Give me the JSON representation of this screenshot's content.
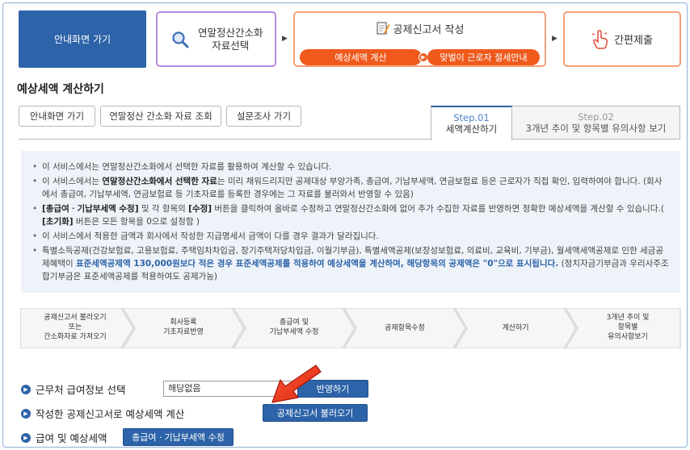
{
  "header": {
    "home_label": "안내화면 가기",
    "step1_line1": "연말정산간소화",
    "step1_line2": "자료선택",
    "step2_title": "공제신고서 작성",
    "step2_pill1": "예상세액 계산",
    "step2_pill2": "맞벌이 근로자 절세안내",
    "step3_label": "간편제출",
    "accent_color": "#2d63a8",
    "orange_color": "#ef5a1c"
  },
  "page_title": "예상세액 계산하기",
  "sub_buttons": {
    "home": "안내화면 가기",
    "simplified_lookup": "연말정산 간소화 자료 조회",
    "survey": "설문조사 가기"
  },
  "tabs": [
    {
      "step": "Step.01",
      "label": "세액계산하기",
      "active": true
    },
    {
      "step": "Step.02",
      "label": "3개년 추이 및 항목별 유의사항 보기",
      "active": false
    }
  ],
  "info": {
    "item1": "이 서비스에서는 연말정산간소화에서 선택한 자료를 활용하여 계산할 수 있습니다.",
    "item2_pre": "이 서비스에서는 ",
    "item2_bold": "연말정산간소화에서 선택한 자료",
    "item2_post": "는 미리 채워드리지만 공제대상 부양가족, 총급여, 기납부세액, 연금보험료 등은 근로자가 직접 확인, 입력하여야 합니다. (회사에서 총급여, 기납부세액, 연금보험료 등 기초자료를 등록한 경우에는 그 자료를 불러와서 반영할 수 있음)",
    "item3_b1": "[총급여ㆍ기납부세액 수정]",
    "item3_mid1": " 및 각 항목의 ",
    "item3_b2": "[수정]",
    "item3_mid2": " 버튼을 클릭하여 올바로 수정하고 연말정산간소화에 없어 추가 수집한 자료를 반영하면 정확한 예상세액을 계산할 수 있습니다.( ",
    "item3_b3": "[초기화]",
    "item3_post": " 버튼은 모든 항목을 0으로 설정함 )",
    "item4": "이 서비스에서 적용한 금액과 회사에서 작성한 지급명세서 금액이 다를 경우 결과가 달라집니다.",
    "item5_pre": "특별소득공제(건강보험료, 고용보험료, 주택임차차입금, 장기주택저당차입금, 이월기부금), 특별세액공제(보장성보험료, 의료비, 교육비, 기부금), 월세액세액공제로 인한 세금공제혜택이 ",
    "item5_blue": "표준세액공제액 130,000원보다 적은 경우 표준세액공제를 적용하여 예상세액을 계산하며, 해당항목의 공제액은 \"0\"으로 표시됩니다.",
    "item5_post": " (정치자금기부금과 우리사주조합기부금은 표준세액공제를 적용하여도 공제가능)"
  },
  "flow": [
    {
      "l1": "공제신고서 불러오기",
      "l2": "또는",
      "l3": "간소화자료 가져오기"
    },
    {
      "l1": "회사등록",
      "l2": "기초자료반영",
      "l3": ""
    },
    {
      "l1": "총급여 및",
      "l2": "기납부세액 수정",
      "l3": ""
    },
    {
      "l1": "공제항목수정",
      "l2": "",
      "l3": ""
    },
    {
      "l1": "계산하기",
      "l2": "",
      "l3": ""
    },
    {
      "l1": "3개년 추이 및",
      "l2": "항목별",
      "l3": "유의사항보기"
    }
  ],
  "rows": {
    "employer_label": "근무처 급여정보 선택",
    "employer_value": "해당없음",
    "apply_button": "반영하기",
    "written_label": "작성한 공제신고서로 예상세액 계산",
    "load_button": "공제신고서 불러오기",
    "salary_label": "급여 및 예상세액",
    "salary_button": "총급여ㆍ기납부세액 수정"
  }
}
